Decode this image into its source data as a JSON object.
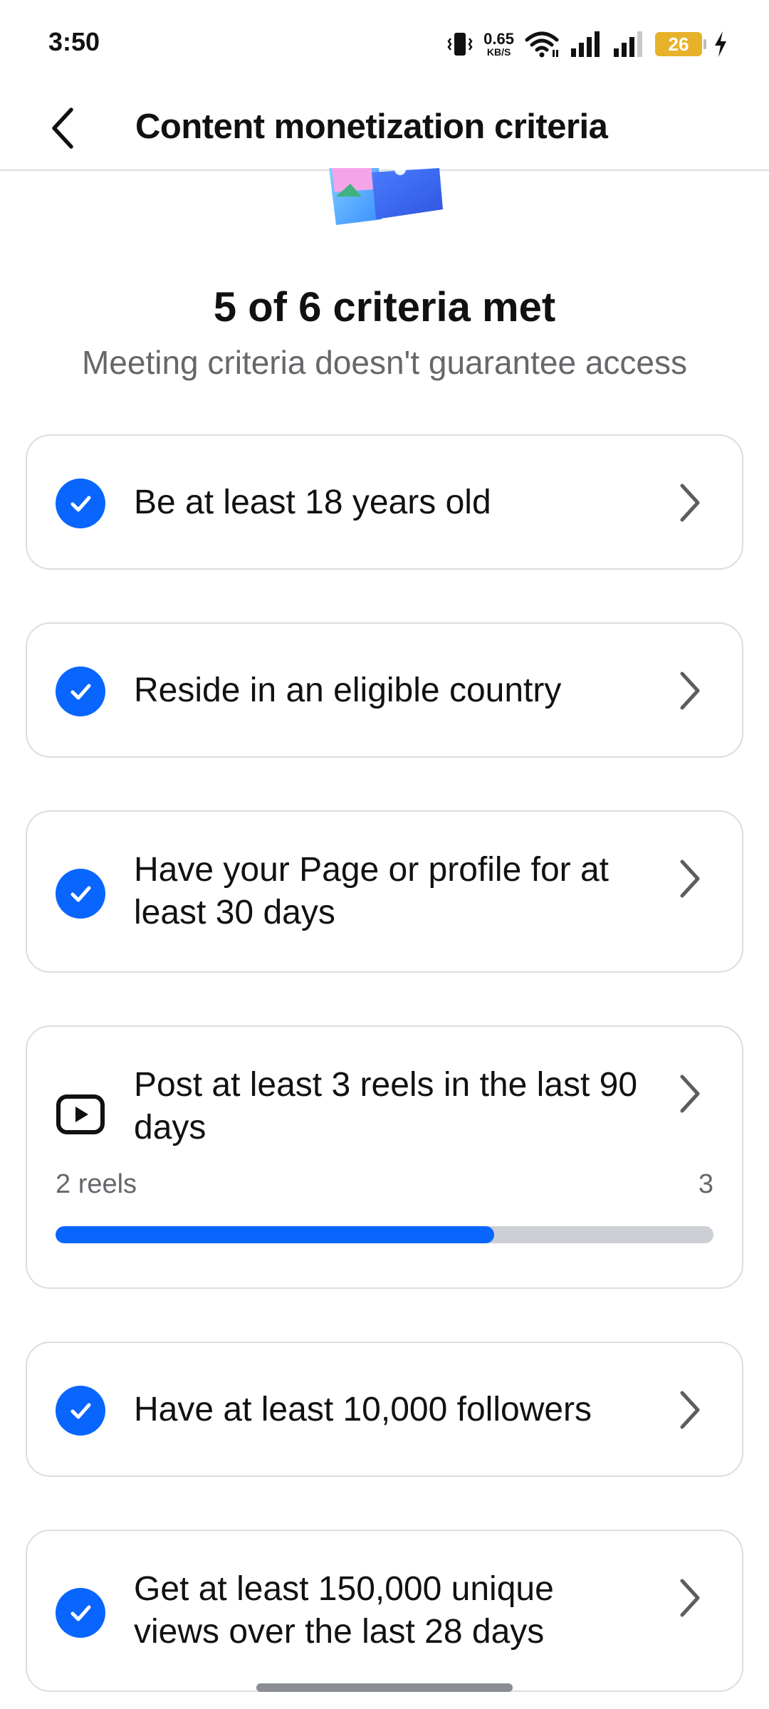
{
  "status_bar": {
    "time": "3:50",
    "net_speed_value": "0.65",
    "net_speed_unit": "KB/S",
    "battery_level": "26",
    "icons": [
      "vibrate-icon",
      "wifi-icon",
      "signal-icon",
      "signal-icon",
      "battery-icon",
      "charging-icon"
    ]
  },
  "header": {
    "title": "Content monetization criteria",
    "back_icon": "back-arrow-icon"
  },
  "summary": {
    "title": "5 of 6 criteria met",
    "subtitle": "Meeting criteria doesn't guarantee access"
  },
  "criteria": [
    {
      "label": "Be at least 18 years old",
      "status": "met",
      "icon": "check-circle-icon"
    },
    {
      "label": "Reside in an eligible country",
      "status": "met",
      "icon": "check-circle-icon"
    },
    {
      "label": "Have your Page or profile for at least 30 days",
      "status": "met",
      "icon": "check-circle-icon"
    },
    {
      "label": "Post at least 3 reels in the last 90 days",
      "status": "in-progress",
      "icon": "reels-icon",
      "progress": {
        "current_label": "2 reels",
        "target_label": "3",
        "current": 2,
        "target": 3,
        "fraction": 0.6667
      }
    },
    {
      "label": "Have at least 10,000 followers",
      "status": "met",
      "icon": "check-circle-icon"
    },
    {
      "label": "Get at least 150,000 unique views over the last 28 days",
      "status": "met",
      "icon": "check-circle-icon"
    }
  ],
  "colors": {
    "accent": "#0866ff",
    "progress_track": "#cccfd4",
    "battery": "#e8b12a",
    "secondary_text": "#65676b",
    "card_border": "#dadde1"
  }
}
